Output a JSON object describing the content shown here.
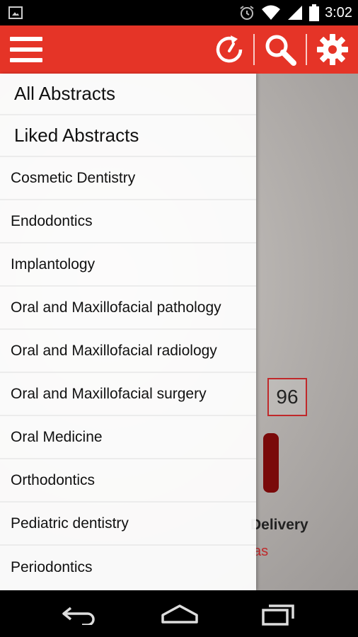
{
  "status_bar": {
    "time": "3:02",
    "icons": [
      "image-icon",
      "alarm-icon",
      "wifi-icon",
      "signal-icon",
      "battery-icon"
    ]
  },
  "app_bar": {
    "color": "#e53427",
    "actions": [
      "refresh-timer-icon",
      "search-icon",
      "settings-gear-icon"
    ]
  },
  "drawer": {
    "primary_items": [
      {
        "label": "All Abstracts"
      },
      {
        "label": "Liked Abstracts"
      }
    ],
    "categories": [
      {
        "label": "Cosmetic Dentistry"
      },
      {
        "label": "Endodontics"
      },
      {
        "label": "Implantology"
      },
      {
        "label": "Oral and Maxillofacial pathology"
      },
      {
        "label": "Oral and Maxillofacial radiology"
      },
      {
        "label": "Oral and Maxillofacial surgery"
      },
      {
        "label": "Oral Medicine"
      },
      {
        "label": "Orthodontics"
      },
      {
        "label": "Pediatric dentistry"
      },
      {
        "label": "Periodontics"
      }
    ]
  },
  "background_content": {
    "count": "96",
    "delivery_fragment": "Delivery",
    "red_fragment": "as"
  },
  "nav_bar": {
    "buttons": [
      "back-icon",
      "home-icon",
      "recent-apps-icon"
    ]
  }
}
